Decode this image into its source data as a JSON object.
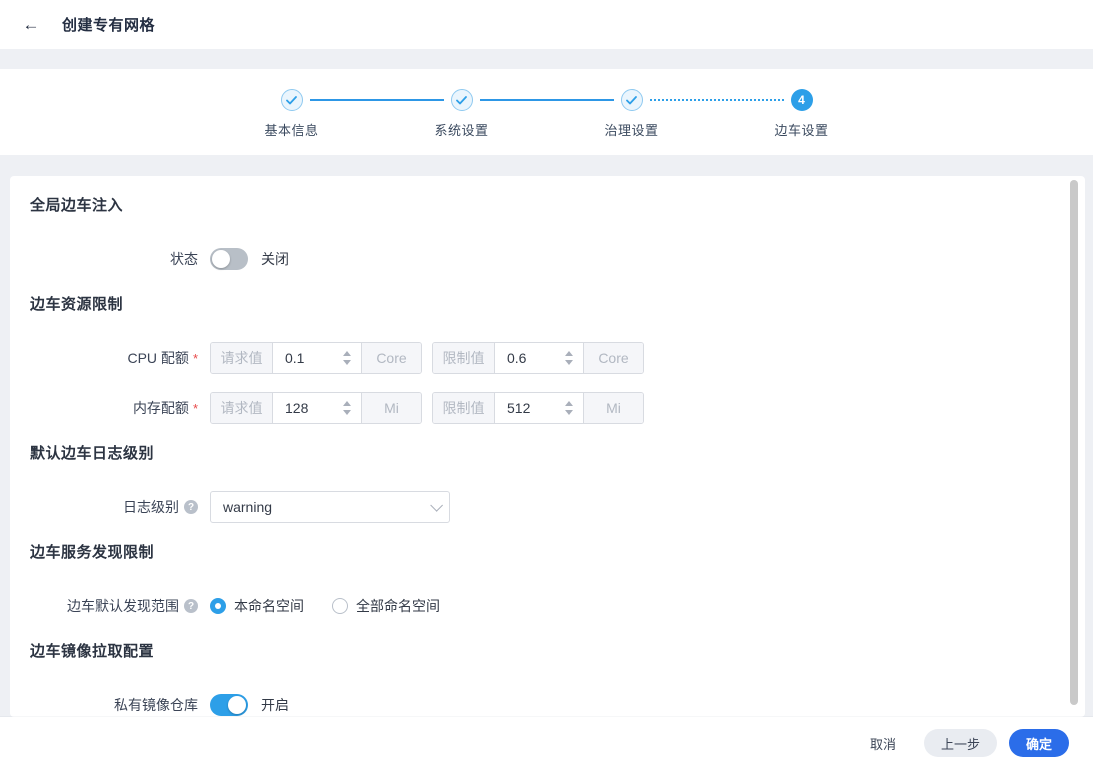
{
  "icons": {
    "back_arrow": "←",
    "help": "?"
  },
  "colors": {
    "primary_button_blue": "#2b6de9",
    "accent_blue": "#2d9fe8",
    "page_bg": "#eef0f4"
  },
  "header": {
    "title": "创建专有网格"
  },
  "stepper": {
    "steps": [
      {
        "label": "基本信息",
        "status": "done"
      },
      {
        "label": "系统设置",
        "status": "done"
      },
      {
        "label": "治理设置",
        "status": "done"
      },
      {
        "label": "边车设置",
        "status": "current",
        "number": "4"
      }
    ]
  },
  "form": {
    "global_sidecar_injection": {
      "heading": "全局边车注入",
      "status_label": "状态",
      "status_value": "关闭",
      "status_on": false
    },
    "sidecar_resource_limit": {
      "heading": "边车资源限制",
      "cpu": {
        "label": "CPU 配额",
        "required": "*",
        "request_label": "请求值",
        "request_value": "0.1",
        "request_unit": "Core",
        "limit_label": "限制值",
        "limit_value": "0.6",
        "limit_unit": "Core"
      },
      "memory": {
        "label": "内存配额",
        "required": "*",
        "request_label": "请求值",
        "request_value": "128",
        "request_unit": "Mi",
        "limit_label": "限制值",
        "limit_value": "512",
        "limit_unit": "Mi"
      }
    },
    "default_log_level": {
      "heading": "默认边车日志级别",
      "label": "日志级别",
      "value": "warning"
    },
    "service_discovery": {
      "heading": "边车服务发现限制",
      "label": "边车默认发现范围",
      "options": [
        {
          "label": "本命名空间",
          "selected": true
        },
        {
          "label": "全部命名空间",
          "selected": false
        }
      ]
    },
    "image_pull": {
      "heading": "边车镜像拉取配置",
      "label": "私有镜像仓库",
      "value": "开启",
      "status_on": true
    }
  },
  "footer": {
    "cancel": "取消",
    "previous": "上一步",
    "confirm": "确定"
  }
}
